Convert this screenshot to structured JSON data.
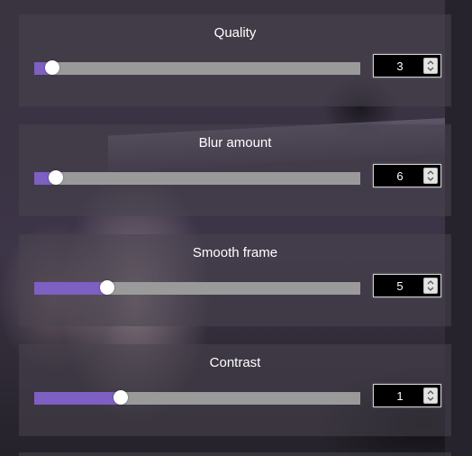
{
  "sliders": [
    {
      "label": "Quality",
      "value": "3",
      "fill_fraction": 0.055
    },
    {
      "label": "Blur amount",
      "value": "6",
      "fill_fraction": 0.065
    },
    {
      "label": "Smooth frame",
      "value": "5",
      "fill_fraction": 0.225
    },
    {
      "label": "Contrast",
      "value": "1",
      "fill_fraction": 0.265
    }
  ],
  "colors": {
    "accent": "#7e5fc2",
    "track": "#9a9a9a",
    "thumb": "#ffffff"
  }
}
